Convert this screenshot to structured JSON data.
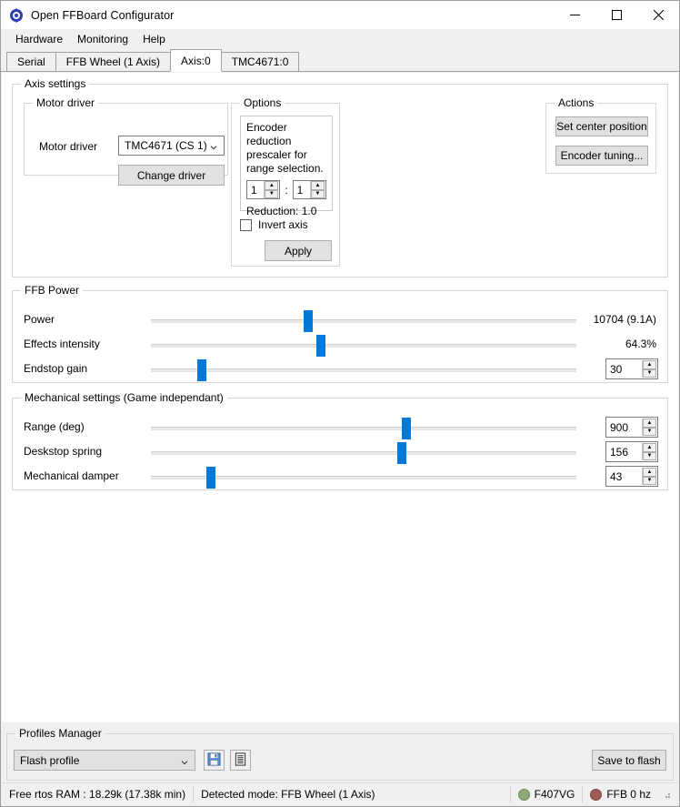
{
  "window": {
    "title": "Open FFBoard Configurator",
    "icon": "app-logo-icon",
    "minimize": "—",
    "maximize": "☐",
    "close": "✕"
  },
  "menubar": {
    "items": [
      {
        "label": "Hardware"
      },
      {
        "label": "Monitoring"
      },
      {
        "label": "Help"
      }
    ]
  },
  "tabs": [
    {
      "label": "Serial",
      "active": false
    },
    {
      "label": "FFB Wheel (1 Axis)",
      "active": false
    },
    {
      "label": "Axis:0",
      "active": true
    },
    {
      "label": "TMC4671:0",
      "active": false
    }
  ],
  "axis_settings": {
    "title": "Axis settings",
    "motor_driver": {
      "title": "Motor driver",
      "label": "Motor driver",
      "selected": "TMC4671 (CS 1)",
      "change_button": "Change driver"
    },
    "options": {
      "title": "Options",
      "description": "Encoder reduction prescaler for range selection.",
      "spin_a": "1",
      "separator": ":",
      "spin_b": "1",
      "reduction": "Reduction: 1.0",
      "invert_axis_label": "Invert axis",
      "invert_axis_checked": false,
      "apply_button": "Apply"
    },
    "actions": {
      "title": "Actions",
      "set_center_button": "Set center position",
      "encoder_tuning_button": "Encoder tuning..."
    }
  },
  "ffb_power": {
    "title": "FFB Power",
    "rows": [
      {
        "label": "Power",
        "value": "10704 (9.1A)",
        "percent": 37,
        "control": "text"
      },
      {
        "label": "Effects intensity",
        "value": "64.3%",
        "percent": 40,
        "control": "text"
      },
      {
        "label": "Endstop gain",
        "value": "30",
        "percent": 12,
        "control": "spin"
      }
    ]
  },
  "mechanical_settings": {
    "title": "Mechanical settings (Game independant)",
    "rows": [
      {
        "label": "Range (deg)",
        "value": "900",
        "percent": 60,
        "control": "spin"
      },
      {
        "label": "Deskstop spring",
        "value": "156",
        "percent": 59,
        "control": "spin"
      },
      {
        "label": "Mechanical damper",
        "value": "43",
        "percent": 14,
        "control": "spin"
      }
    ]
  },
  "profiles_manager": {
    "title": "Profiles Manager",
    "selected_profile": "Flash profile",
    "save_icon": "floppy-disk-icon",
    "list_icon": "document-list-icon",
    "save_to_flash_button": "Save to flash"
  },
  "statusbar": {
    "ram": "Free rtos RAM : 18.29k (17.38k min)",
    "mode": "Detected mode: FFB Wheel (1 Axis)",
    "indicators": [
      {
        "label": "F407VG",
        "color": "#8faa77"
      },
      {
        "label": "FFB 0 hz",
        "color": "#a05a56"
      }
    ]
  },
  "colors": {
    "accent": "#0078d7",
    "slider_track": "#e8e8e8",
    "window_bg": "#f0f0f0"
  }
}
